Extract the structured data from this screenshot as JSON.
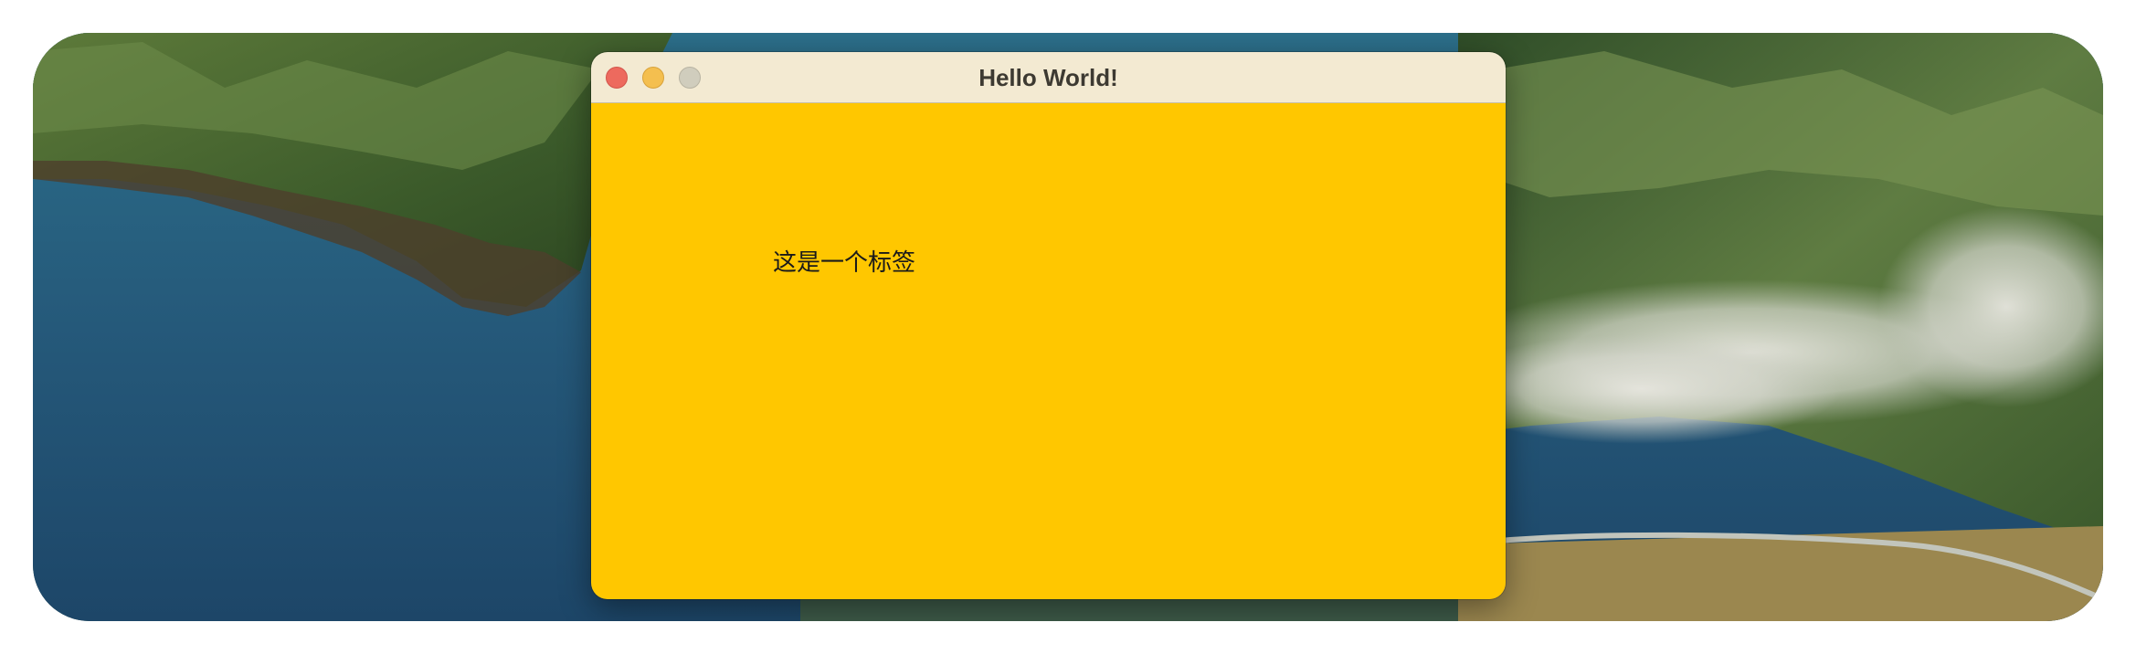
{
  "window": {
    "title": "Hello World!",
    "controls": [
      "close",
      "minimize",
      "zoom"
    ],
    "background_color": "#ffc700",
    "titlebar_color": "#f3ead2"
  },
  "content": {
    "label_text": "这是一个标签"
  },
  "desktop": {
    "wallpaper": "coastal mountains landscape"
  },
  "colors": {
    "close": "#ed6a5e",
    "minimize": "#f4bf4f",
    "zoom_inactive": "#d0cdbd"
  }
}
